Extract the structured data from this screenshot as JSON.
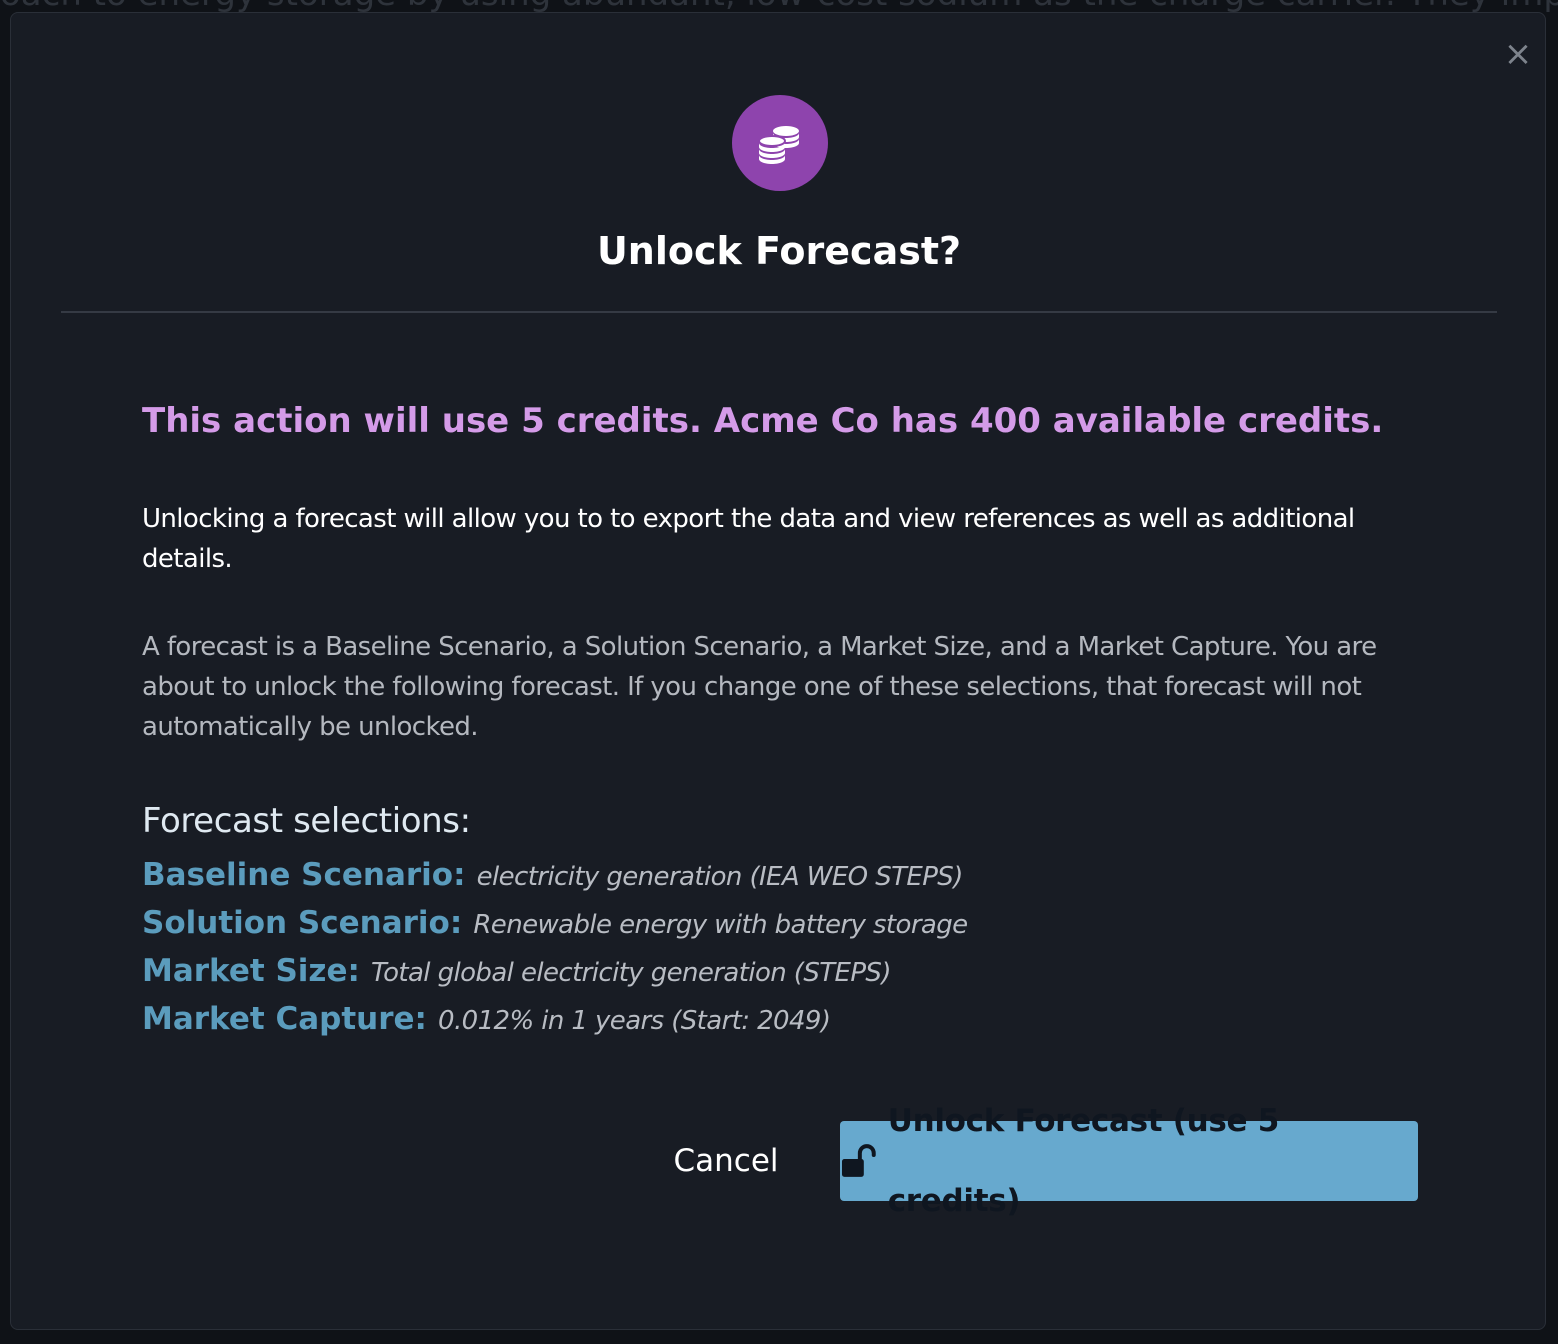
{
  "background": {
    "text": "oach to energy storage by using abundant, low-cost sodium as the charge carrier. They improve energy den"
  },
  "modal": {
    "title": "Unlock Forecast?",
    "close_glyph": "×",
    "icon": "coins-icon",
    "credit_message": "This action will use 5 credits. Acme Co has 400 available credits.",
    "description": "Unlocking a forecast will allow you to to export the data and view references as well as additional details.",
    "explanation": "A forecast is a Baseline Scenario, a Solution Scenario, a Market Size, and a Market Capture. You are about to unlock the following forecast. If you change one of these selections, that forecast will not automatically be unlocked.",
    "selections_heading": "Forecast selections:",
    "selections": [
      {
        "label": "Baseline Scenario:",
        "value": "electricity generation (IEA WEO STEPS)"
      },
      {
        "label": "Solution Scenario:",
        "value": "Renewable energy with battery storage"
      },
      {
        "label": "Market Size:",
        "value": "Total global electricity generation (STEPS)"
      },
      {
        "label": "Market Capture:",
        "value": "0.012% in 1 years (Start: 2049)"
      }
    ],
    "cancel_label": "Cancel",
    "unlock_label": "Unlock Forecast (use 5 credits)",
    "unlock_icon": "unlock-icon"
  },
  "colors": {
    "modal_bg": "#181c24",
    "accent_purple": "#8e44ad",
    "credit_text": "#d49be8",
    "selection_label": "#5b9cbd",
    "primary_button": "#67a9ce"
  }
}
